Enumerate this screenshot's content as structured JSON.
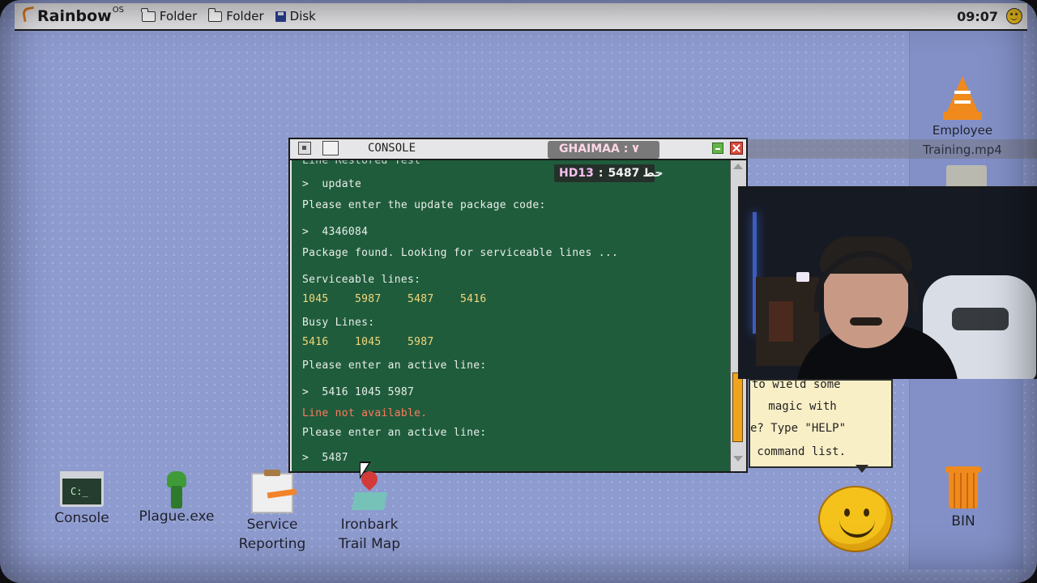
{
  "menubar": {
    "logo": "Rainbow",
    "logo_sup": "OS",
    "items": [
      {
        "label": "Folder",
        "icon": "folder-icon"
      },
      {
        "label": "Folder",
        "icon": "folder-icon"
      },
      {
        "label": "Disk",
        "icon": "disk-icon"
      }
    ],
    "clock": "09:07"
  },
  "console": {
    "title": "CONSOLE",
    "lines": {
      "cut": "Line Restored Test",
      "l1": ">  update",
      "l2": "Please enter the update package code:",
      "l3": ">  4346084",
      "l4": "Package found. Looking for serviceable lines ...",
      "l5": "Serviceable lines:",
      "l6": "1045    5987    5487    5416",
      "l7": "Busy Lines:",
      "l8": "5416    1045    5987",
      "l9": "Please enter an active line:",
      "l10": ">  5416 1045 5987",
      "l11": "Line not available.",
      "l12": "Please enter an active line:",
      "l13": ">  5487"
    }
  },
  "overlay": {
    "stream_name": "GHAIMAA : ٧",
    "hd_label": "HD13",
    "hd_sep": ":",
    "hd_value": "5487",
    "hd_suffix": "حط"
  },
  "bubble": {
    "l1": "to wield some",
    "l2": " magic with",
    "l3": "e? Type \"HELP\"",
    "l4": " command list."
  },
  "desktop_icons": {
    "console": "Console",
    "plague": "Plague.exe",
    "service_1": "Service",
    "service_2": "Reporting",
    "map_1": "Ironbark",
    "map_2": "Trail Map",
    "video_1": "Employee",
    "video_2": "Training.mp4",
    "bin": "BIN"
  },
  "colors": {
    "desktop": "#8e9bcf",
    "terminal_bg": "#1f5c3c",
    "terminal_text": "#e8eee9",
    "highlight_numbers": "#f2d77a",
    "error_text": "#ff7a5b",
    "scroll_thumb": "#f0a31b"
  }
}
